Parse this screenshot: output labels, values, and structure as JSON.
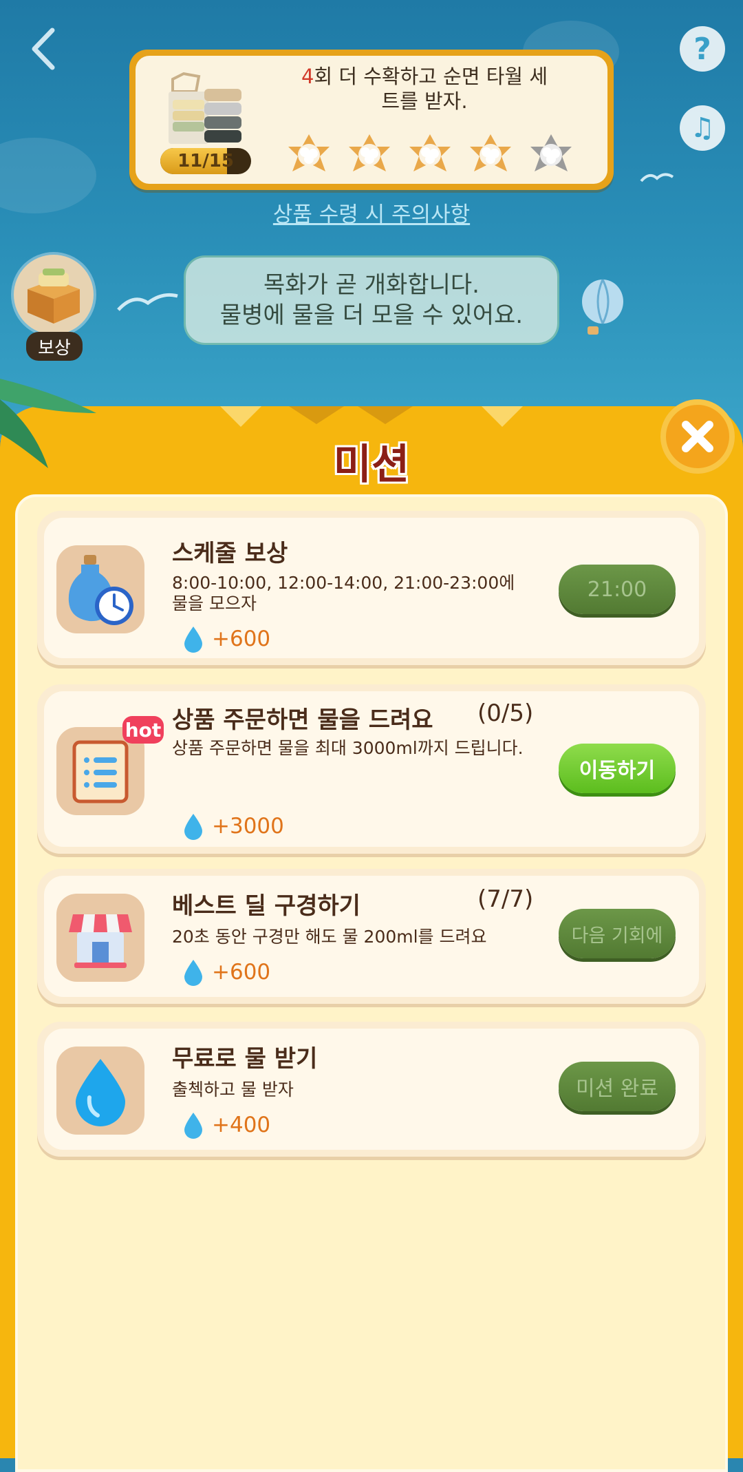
{
  "header": {
    "back_icon": "chevron-left-icon",
    "help_icon": "question-icon",
    "help_label": "?",
    "music_icon": "music-note-icon",
    "music_label": "♫"
  },
  "harvest": {
    "progress_text": "11/15",
    "progress_value": 0.733,
    "message_num": "4",
    "message_line1": "회 더 수확하고 순면 타월 세",
    "message_line2": "트를 받자.",
    "flowers_bloomed": 4,
    "flowers_total": 5
  },
  "notice_link": "상품 수령 시 주의사항",
  "reward": {
    "label": "보상"
  },
  "bubble": {
    "line1": "목화가 곧 개화합니다.",
    "line2": "물병에 물을 더 모을 수 있어요."
  },
  "panel": {
    "title": "미션",
    "close_icon": "close-icon"
  },
  "missions": [
    {
      "title": "스케줄 보상",
      "count": "",
      "desc": "8:00-10:00, 12:00-14:00, 21:00-23:00에 물을 모으자",
      "reward": "+600",
      "button": "21:00",
      "button_state": "disabled",
      "icon": "water-bottle-clock-icon",
      "hot": ""
    },
    {
      "title": "상품 주문하면 물을 드려요",
      "count": "(0/5)",
      "desc": "상품 주문하면 물을 최대 3000ml까지 드립니다.",
      "reward": "+3000",
      "button": "이동하기",
      "button_state": "active",
      "icon": "order-list-icon",
      "hot": "hot"
    },
    {
      "title": "베스트 딜 구경하기",
      "count": "(7/7)",
      "desc": "20초 동안 구경만 해도 물 200ml를 드려요",
      "reward": "+600",
      "button": "다음 기회에",
      "button_state": "disabled",
      "icon": "store-icon",
      "hot": ""
    },
    {
      "title": "무료로 물 받기",
      "count": "",
      "desc": "출첵하고 물 받자",
      "reward": "+400",
      "button": "미션 완료",
      "button_state": "disabled",
      "icon": "water-drop-icon",
      "hot": ""
    }
  ],
  "colors": {
    "panel": "#f6b60e",
    "reward_text": "#e0741a",
    "active_button": "#5cbd1e",
    "disabled_button": "#527a32"
  }
}
